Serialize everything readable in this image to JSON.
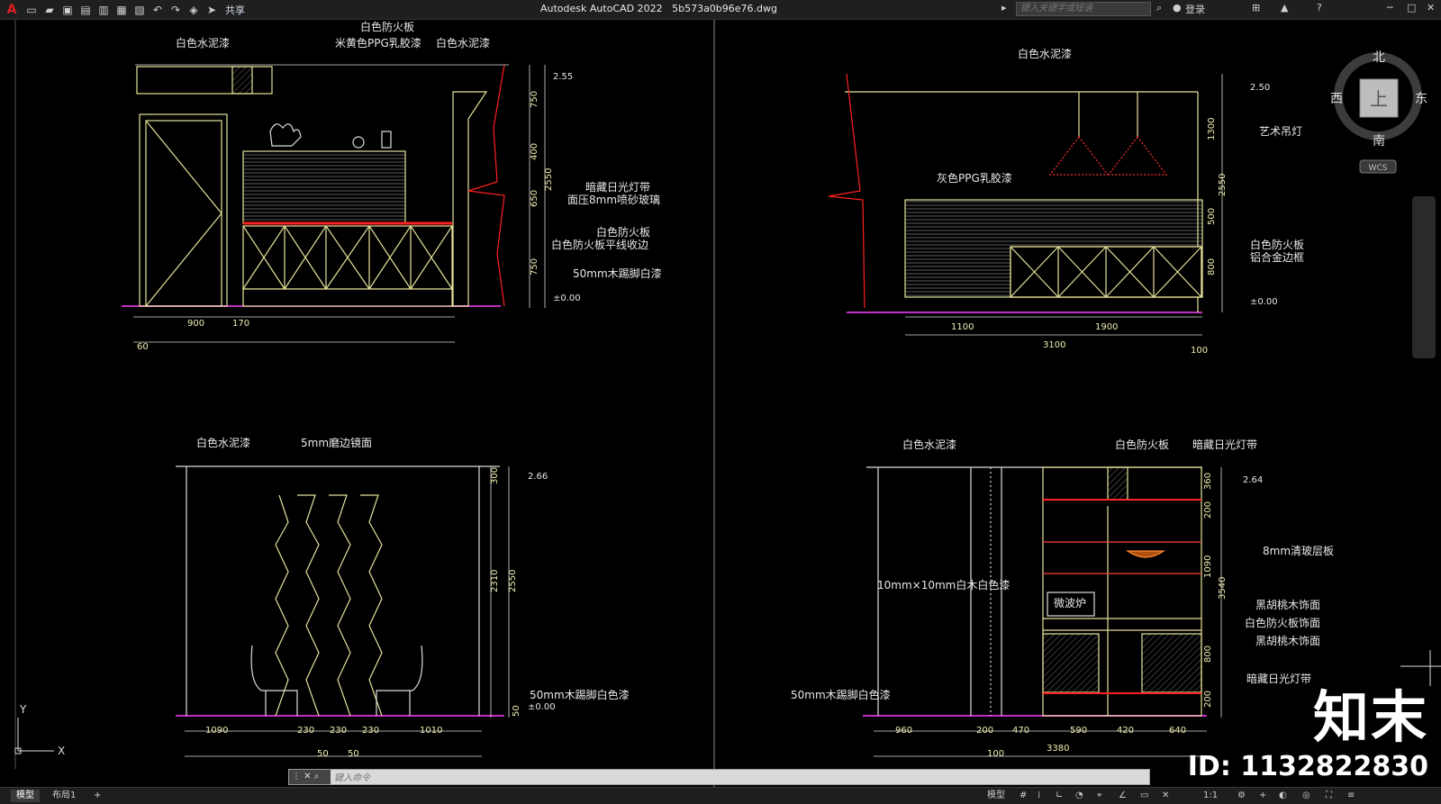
{
  "app": {
    "logo": "A",
    "title": "Autodesk AutoCAD 2022",
    "filename": "5b573a0b96e76.dwg",
    "share_label": "共享",
    "search_placeholder": "键入关键字或短语",
    "login_label": "登录"
  },
  "viewcube": {
    "north": "北",
    "south": "南",
    "east": "东",
    "west": "西",
    "top": "上",
    "wcs": "WCS"
  },
  "ucs": {
    "x": "X",
    "y": "Y"
  },
  "command": {
    "placeholder": "键入命令"
  },
  "status": {
    "tabs": [
      "模型",
      "布局1"
    ],
    "add_tab": "+",
    "model_label": "模型",
    "scale": "1:1"
  },
  "watermark": {
    "logo": "知末",
    "id": "ID: 1132822830"
  },
  "views": {
    "tl": {
      "labels": [
        "白色水泥漆",
        "白色防火板",
        "米黄色PPG乳胶漆",
        "白色水泥漆",
        "暗藏日光灯带",
        "面压8mm喷砂玻璃",
        "白色防火板",
        "白色防火板平线收边",
        "50mm木踢脚白漆"
      ],
      "levels": [
        "2.55",
        "±0.00"
      ],
      "dims_v": [
        "750",
        "400",
        "650",
        "750",
        "2550"
      ],
      "dims_h": [
        "900",
        "170",
        "60"
      ]
    },
    "tr": {
      "labels": [
        "白色水泥漆",
        "艺术吊灯",
        "灰色PPG乳胶漆",
        "白色防火板",
        "铝合金边框"
      ],
      "levels": [
        "2.50",
        "±0.00"
      ],
      "dims_v": [
        "1300",
        "500",
        "800",
        "2550"
      ],
      "dims_h": [
        "1100",
        "1900",
        "3100",
        "100"
      ]
    },
    "bl": {
      "labels": [
        "白色水泥漆",
        "5mm磨边镜面",
        "50mm木踢脚白色漆"
      ],
      "levels": [
        "2.66",
        "±0.00"
      ],
      "dims_v": [
        "300",
        "2310",
        "2550",
        "50"
      ],
      "dims_h": [
        "1090",
        "230",
        "230",
        "230",
        "1010",
        "50",
        "50"
      ]
    },
    "br": {
      "labels": [
        "白色水泥漆",
        "白色防火板",
        "暗藏日光灯带",
        "8mm清玻层板",
        "10mm×10mm白木白色漆",
        "黑胡桃木饰面",
        "白色防火板饰面",
        "黑胡桃木饰面",
        "暗藏日光灯带",
        "50mm木踢脚白色漆",
        "微波炉"
      ],
      "levels": [
        "2.64"
      ],
      "dims_v": [
        "360",
        "200",
        "1090",
        "3540",
        "800",
        "200"
      ],
      "dims_h": [
        "960",
        "200",
        "470",
        "590",
        "420",
        "640",
        "3380",
        "100"
      ]
    }
  }
}
